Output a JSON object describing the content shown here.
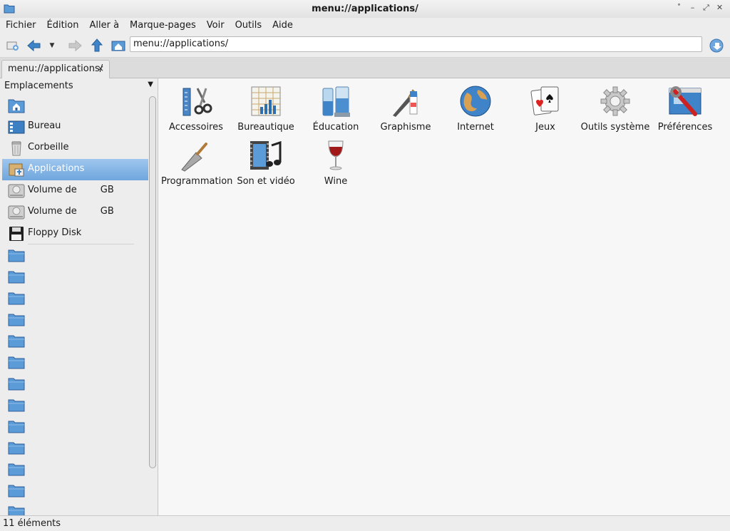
{
  "window": {
    "title": "menu://applications/"
  },
  "menubar": [
    "Fichier",
    "Édition",
    "Aller à",
    "Marque-pages",
    "Voir",
    "Outils",
    "Aide"
  ],
  "address": {
    "value": "menu://applications/"
  },
  "tab": {
    "label": "menu://applications/",
    "close": "×"
  },
  "sidebar": {
    "header": "Emplacements",
    "places": [
      {
        "label": "",
        "icon": "home-icon"
      },
      {
        "label": "Bureau",
        "icon": "desktop-icon"
      },
      {
        "label": "Corbeille",
        "icon": "trash-icon"
      },
      {
        "label": "Applications",
        "icon": "applications-icon",
        "selected": true
      },
      {
        "label": "Volume de        GB",
        "icon": "drive-icon"
      },
      {
        "label": "Volume de        GB",
        "icon": "drive-icon"
      },
      {
        "label": "Floppy Disk",
        "icon": "floppy-icon"
      }
    ]
  },
  "apps": [
    {
      "label": "Accessoires",
      "icon": "accessories-icon"
    },
    {
      "label": "Bureautique",
      "icon": "office-icon"
    },
    {
      "label": "Éducation",
      "icon": "education-icon"
    },
    {
      "label": "Graphisme",
      "icon": "graphics-icon"
    },
    {
      "label": "Internet",
      "icon": "internet-icon"
    },
    {
      "label": "Jeux",
      "icon": "games-icon"
    },
    {
      "label": "Outils système",
      "icon": "system-tools-icon"
    },
    {
      "label": "Préférences",
      "icon": "preferences-icon"
    },
    {
      "label": "Programmation",
      "icon": "programming-icon"
    },
    {
      "label": "Son et vidéo",
      "icon": "sound-video-icon"
    },
    {
      "label": "Wine",
      "icon": "wine-icon"
    }
  ],
  "status": "11 éléments",
  "colors": {
    "selection": "#7fb1e2",
    "folder": "#5b9bd8"
  }
}
